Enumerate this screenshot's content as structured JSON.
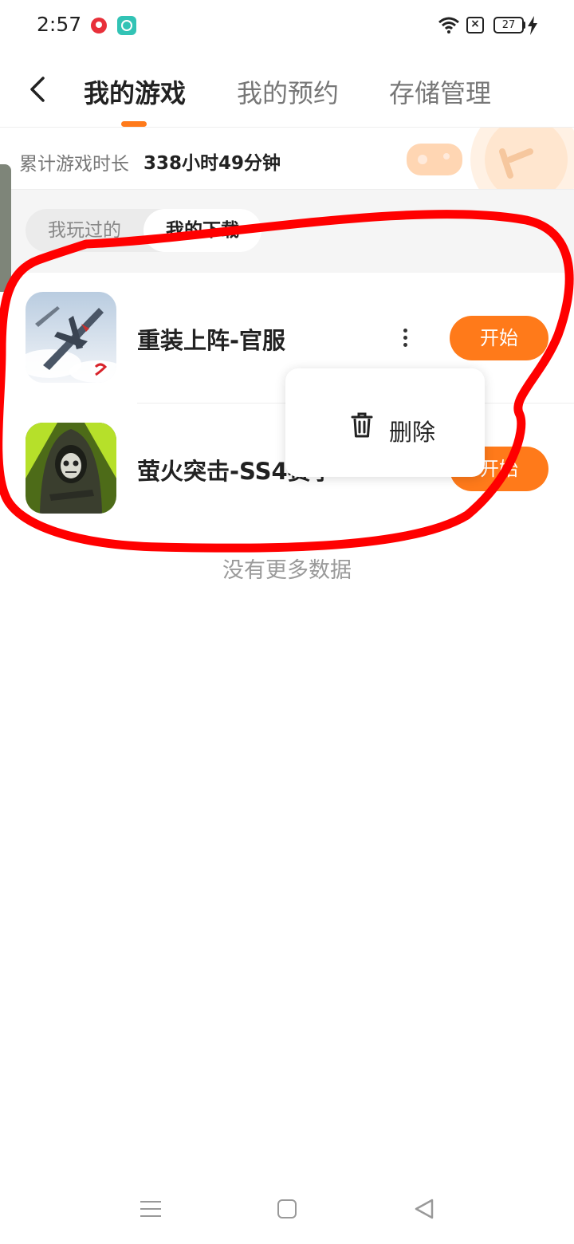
{
  "status_bar": {
    "time": "2:57",
    "battery": "27",
    "icons": [
      "app-notification-icon",
      "chat-app-icon",
      "wifi-icon",
      "sim-off-icon",
      "battery-icon",
      "charging-icon"
    ]
  },
  "header": {
    "back_icon": "chevron-left-icon",
    "tabs": [
      {
        "label": "我的游戏",
        "active": true
      },
      {
        "label": "我的预约",
        "active": false
      },
      {
        "label": "存储管理",
        "active": false
      }
    ],
    "accent_color": "#ff7a1a"
  },
  "playtime": {
    "label": "累计游戏时长",
    "value": "338小时49分钟"
  },
  "segments": [
    {
      "label": "我玩过的",
      "selected": false
    },
    {
      "label": "我的下载",
      "selected": true
    }
  ],
  "games": [
    {
      "name": "重装上阵-官服",
      "button": "开始",
      "icon": "jet-game-icon"
    },
    {
      "name": "萤火突击-SS4赛季",
      "button": "开始",
      "icon": "soldier-game-icon"
    }
  ],
  "popup_menu": {
    "icon": "trash-icon",
    "label": "删除"
  },
  "empty_hint": "没有更多数据",
  "annotation_color": "#ff0000",
  "navbar": {
    "icons": [
      "menu-icon",
      "home-icon",
      "back-triangle-icon"
    ]
  }
}
